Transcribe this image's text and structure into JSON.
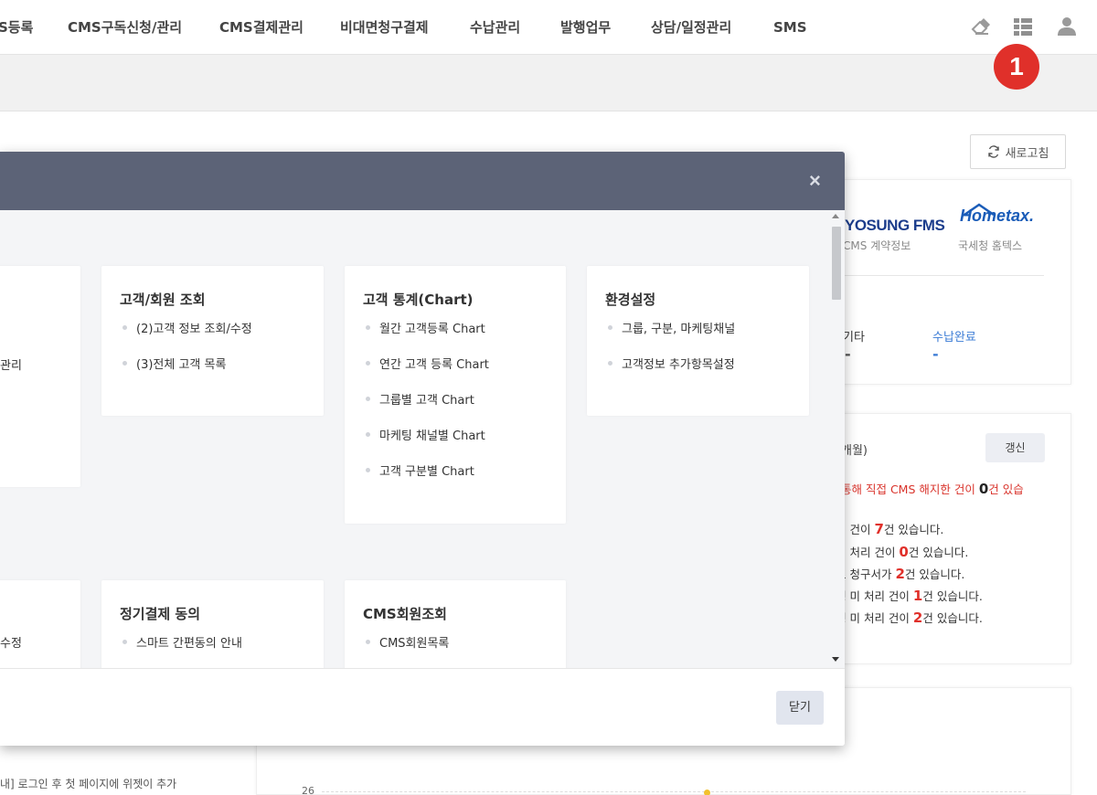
{
  "nav": {
    "items": [
      "S등록",
      "CMS구독신청/관리",
      "CMS결제관리",
      "비대면청구결제",
      "수납관리",
      "발행업무",
      "상담/일정관리",
      "SMS"
    ],
    "badge": "1"
  },
  "background": {
    "refresh_label": "새로고침",
    "logos": {
      "hyosung": "YOSUNG FMS",
      "hyosung_caption": "CMS 계약정보",
      "hometax": "Hometax.",
      "hometax_caption": "국세청 홈텍스"
    },
    "stats": [
      {
        "label": "기타",
        "value": "-",
        "color": "#555555"
      },
      {
        "label": "수납완료",
        "value": "-",
        "color": "#3a7bd5"
      }
    ],
    "month_text": "개월)",
    "renew_label": "갱신",
    "notice_red_prefix": "통해 직접 CMS 해지한 건이 ",
    "notice_red_count": "0",
    "notice_red_suffix": "건 있습",
    "notices": [
      {
        "prefix": "리 건이 ",
        "count": "7",
        "suffix": "건 있습니다."
      },
      {
        "prefix": "미 처리 건이 ",
        "count": "0",
        "suffix": "건 있습니다."
      },
      {
        "prefix": "로 청구서가 ",
        "count": "2",
        "suffix": "건 있습니다."
      },
      {
        "prefix": "행 미 처리 건이 ",
        "count": "1",
        "suffix": "건 있습니다."
      },
      {
        "prefix": "행 미 처리 건이 ",
        "count": "2",
        "suffix": "건 있습니다."
      }
    ],
    "left_notice": "내] 로그인 후 첫 페이지에 위젯이 추가",
    "chart_tick": "26"
  },
  "modal": {
    "close_icon": "×",
    "cards": [
      {
        "title": "고객/회원 조회",
        "items": [
          "(2)고객 정보 조회/수정",
          "(3)전체 고객 목록"
        ]
      },
      {
        "title": "고객 통계(Chart)",
        "items": [
          "월간 고객등록 Chart",
          "연간 고객 등록 Chart",
          "그룹별 고객 Chart",
          "마케팅 채널별 Chart",
          "고객 구분별 Chart"
        ]
      },
      {
        "title": "환경설정",
        "items": [
          "그룹, 구분, 마케팅채널",
          "고객정보 추가항목설정"
        ]
      },
      {
        "title": "정기결제 동의",
        "items": [
          "스마트 간편동의 안내"
        ]
      },
      {
        "title": "CMS회원조회",
        "items": [
          "CMS회원목록"
        ]
      }
    ],
    "left_fragments": [
      "관리",
      "수정"
    ],
    "close_label": "닫기"
  }
}
